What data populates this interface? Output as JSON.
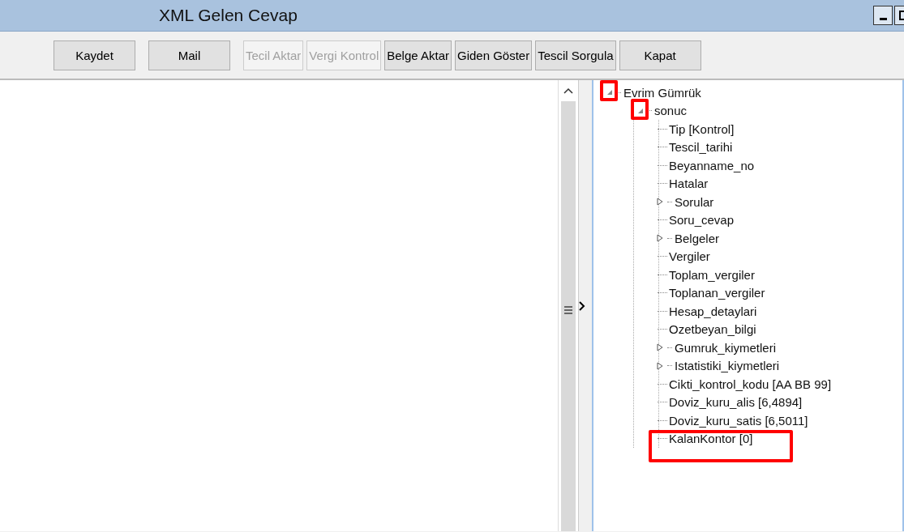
{
  "window": {
    "title": "XML Gelen Cevap"
  },
  "toolbar": [
    {
      "label": "Kaydet",
      "disabled": false,
      "kind": "wide"
    },
    {
      "label": "Mail",
      "disabled": false,
      "kind": "wide"
    },
    {
      "label": "Tecil Aktar",
      "disabled": true,
      "kind": "narrow"
    },
    {
      "label": "Vergi Kontrol",
      "disabled": true,
      "kind": "narrow"
    },
    {
      "label": "Belge Aktar",
      "disabled": false,
      "kind": "narrow"
    },
    {
      "label": "Giden Göster",
      "disabled": false,
      "kind": "narrow"
    },
    {
      "label": "Tescil Sorgula",
      "disabled": false,
      "kind": "narrow"
    },
    {
      "label": "Kapat",
      "disabled": false,
      "kind": "wide"
    }
  ],
  "tree": [
    {
      "label": "Evrim Gümrük",
      "expanded": true,
      "highlighted": true,
      "children": [
        {
          "label": "sonuc",
          "expanded": true,
          "highlighted": true,
          "children": [
            {
              "label": "Tip [Kontrol]"
            },
            {
              "label": "Tescil_tarihi"
            },
            {
              "label": "Beyanname_no"
            },
            {
              "label": "Hatalar"
            },
            {
              "label": "Sorular",
              "expanded": false
            },
            {
              "label": "Soru_cevap"
            },
            {
              "label": "Belgeler",
              "expanded": false
            },
            {
              "label": "Vergiler"
            },
            {
              "label": "Toplam_vergiler"
            },
            {
              "label": "Toplanan_vergiler"
            },
            {
              "label": "Hesap_detaylari"
            },
            {
              "label": "Ozetbeyan_bilgi"
            },
            {
              "label": "Gumruk_kiymetleri",
              "expanded": false
            },
            {
              "label": "Istatistiki_kiymetleri",
              "expanded": false
            },
            {
              "label": "Cikti_kontrol_kodu [AA BB 99]"
            },
            {
              "label": "Doviz_kuru_alis [6,4894]"
            },
            {
              "label": "Doviz_kuru_satis [6,5011]"
            },
            {
              "label": "KalanKontor [0]",
              "highlighted": true
            }
          ]
        }
      ]
    }
  ]
}
